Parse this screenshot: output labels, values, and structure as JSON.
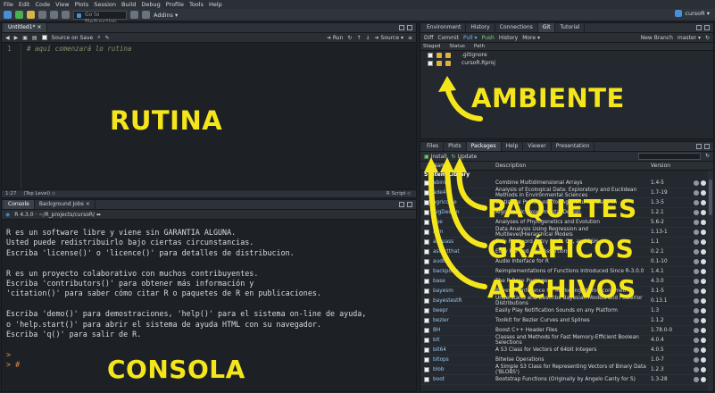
{
  "menu": [
    "File",
    "Edit",
    "Code",
    "View",
    "Plots",
    "Session",
    "Build",
    "Debug",
    "Profile",
    "Tools",
    "Help"
  ],
  "toolbar": {
    "goto_placeholder": "Go to file/function",
    "addins": "Addins ▾"
  },
  "project_name": "cursoR ▾",
  "editor": {
    "tab": "Untitled1* ×",
    "source_on_save": "Source on Save",
    "run": "➜ Run",
    "source": "➜ Source ▾",
    "line_number": "1",
    "code_line": "# aquí comenzará lo rutina",
    "cursor_pos": "1:27",
    "scope": "(Top Level) ⬦",
    "file_type": "R Script ⬦"
  },
  "labels": {
    "rutina": "RUTINA",
    "consola": "CONSOLA",
    "ambiente": "AMBIENTE",
    "paquetes": "PAQUETES",
    "graficos": "GRÁFICOS",
    "archivos": "ARCHIVOS"
  },
  "console": {
    "tabs": [
      "Console",
      "Background Jobs ×"
    ],
    "path": "R 4.3.0 · ~/R_projects/cursoR/ ➦",
    "lines": [
      "R es un software libre y viene sin GARANTIA ALGUNA.",
      "Usted puede redistribuirlo bajo ciertas circunstancias.",
      "Escriba 'license()' o 'licence()' para detalles de distribucion.",
      "",
      "R es un proyecto colaborativo con muchos contribuyentes.",
      "Escriba 'contributors()' para obtener más información y",
      "'citation()' para saber cómo citar R o paquetes de R en publicaciones.",
      "",
      "Escriba 'demo()' para demostraciones, 'help()' para el sistema on-line de ayuda,",
      "o 'help.start()' para abrir el sistema de ayuda HTML con su navegador.",
      "Escriba 'q()' para salir de R.",
      ""
    ],
    "prompt1": ">",
    "prompt2": "> #"
  },
  "env": {
    "tabs": [
      "Environment",
      "History",
      "Connections",
      "Git",
      "Tutorial"
    ],
    "actions": [
      "Diff",
      "Commit",
      "Pull ▾",
      "Push",
      "History",
      "More ▾"
    ],
    "new_branch": "New Branch",
    "branch": "master ▾",
    "cols": [
      "Staged",
      "Status",
      "Path"
    ],
    "files": [
      ".gitignore",
      "cursoR.Rproj"
    ]
  },
  "files_pane": {
    "tabs": [
      "Files",
      "Plots",
      "Packages",
      "Help",
      "Viewer",
      "Presentation"
    ],
    "install": "Install",
    "update": "Update",
    "cols": [
      "Name",
      "Description",
      "Version"
    ],
    "system_library": "System Library",
    "packages": [
      {
        "name": "abind",
        "desc": "Combine Multidimensional Arrays",
        "ver": "1.4-5"
      },
      {
        "name": "ade4",
        "desc": "Analysis of Ecological Data: Exploratory and Euclidean Methods in Environmental Sciences",
        "ver": "1.7-19"
      },
      {
        "name": "agricolae",
        "desc": "Statistical Procedures for Agricultural Research",
        "ver": "1.3-5"
      },
      {
        "name": "AlgDesign",
        "desc": "Algorithmic Experimental Design",
        "ver": "1.2.1"
      },
      {
        "name": "ape",
        "desc": "Analyses of Phylogenetics and Evolution",
        "ver": "5.6-2"
      },
      {
        "name": "arm",
        "desc": "Data Analysis Using Regression and Multilevel/Hierarchical Models",
        "ver": "1.13-1"
      },
      {
        "name": "askpass",
        "desc": "Safe Password Entry for R, Git, and SSH",
        "ver": "1.1"
      },
      {
        "name": "assertthat",
        "desc": "Easy Pre and Post Assertions",
        "ver": "0.2.1"
      },
      {
        "name": "audio",
        "desc": "Audio Interface for R",
        "ver": "0.1-10"
      },
      {
        "name": "backports",
        "desc": "Reimplementations of Functions Introduced Since R-3.0.0",
        "ver": "1.4.1"
      },
      {
        "name": "base",
        "desc": "The R Base Package",
        "ver": "4.3.0"
      },
      {
        "name": "bayesm",
        "desc": "Bayesian Inference for Marketing/Micro-Econometrics",
        "ver": "3.1-5"
      },
      {
        "name": "bayestestR",
        "desc": "Understand and Describe Bayesian Models and Posterior Distributions",
        "ver": "0.13.1"
      },
      {
        "name": "beepr",
        "desc": "Easily Play Notification Sounds on any Platform",
        "ver": "1.3"
      },
      {
        "name": "bezier",
        "desc": "Toolkit for Bezier Curves and Splines",
        "ver": "1.1.2"
      },
      {
        "name": "BH",
        "desc": "Boost C++ Header Files",
        "ver": "1.78.0-0"
      },
      {
        "name": "bit",
        "desc": "Classes and Methods for Fast Memory-Efficient Boolean Selections",
        "ver": "4.0.4"
      },
      {
        "name": "bit64",
        "desc": "A S3 Class for Vectors of 64bit Integers",
        "ver": "4.0.5"
      },
      {
        "name": "bitops",
        "desc": "Bitwise Operations",
        "ver": "1.0-7"
      },
      {
        "name": "blob",
        "desc": "A Simple S3 Class for Representing Vectors of Binary Data ('BLOBS')",
        "ver": "1.2.3"
      },
      {
        "name": "boot",
        "desc": "Bootstrap Functions (Originally by Angelo Canty for S)",
        "ver": "1.3-28"
      }
    ]
  },
  "colors": {
    "accent_label": "#f5e61c",
    "background": "#1f2329"
  }
}
